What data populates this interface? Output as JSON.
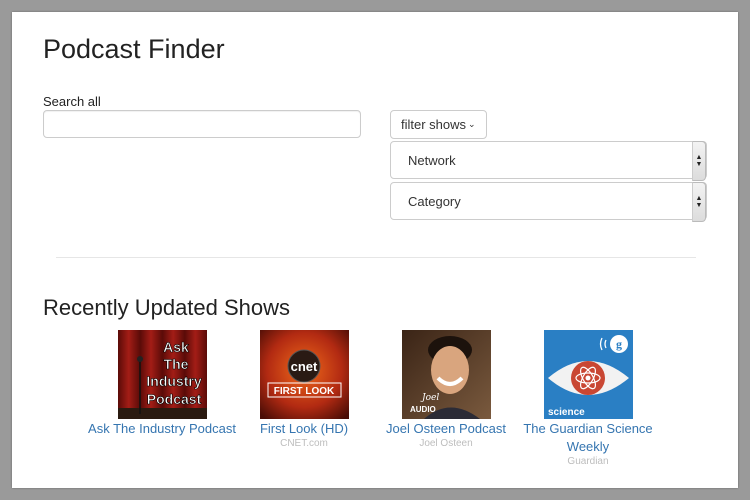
{
  "header": {
    "title": "Podcast Finder"
  },
  "search": {
    "label": "Search all",
    "value": "",
    "placeholder": ""
  },
  "filter": {
    "button_label": "filter shows",
    "caret": "⌄"
  },
  "selects": {
    "network": {
      "selected": "Network"
    },
    "category": {
      "selected": "Category"
    }
  },
  "recent": {
    "title": "Recently Updated Shows",
    "shows": [
      {
        "name": "Ask The Industry Podcast",
        "network": "",
        "art_text": [
          "Ask",
          "The",
          "Industry",
          "Podcast"
        ]
      },
      {
        "name": "First Look (HD)",
        "network": "CNET.com",
        "art_logo": "cnet",
        "art_caption": "FIRST LOOK"
      },
      {
        "name": "Joel Osteen Podcast",
        "network": "Joel Osteen",
        "art_caption": "AUDIO"
      },
      {
        "name": "The Guardian Science Weekly",
        "network": "Guardian",
        "art_caption": "science"
      }
    ]
  },
  "colors": {
    "link": "#3575b0",
    "muted": "#bdbdbd",
    "frame": "#9a9a9a"
  }
}
